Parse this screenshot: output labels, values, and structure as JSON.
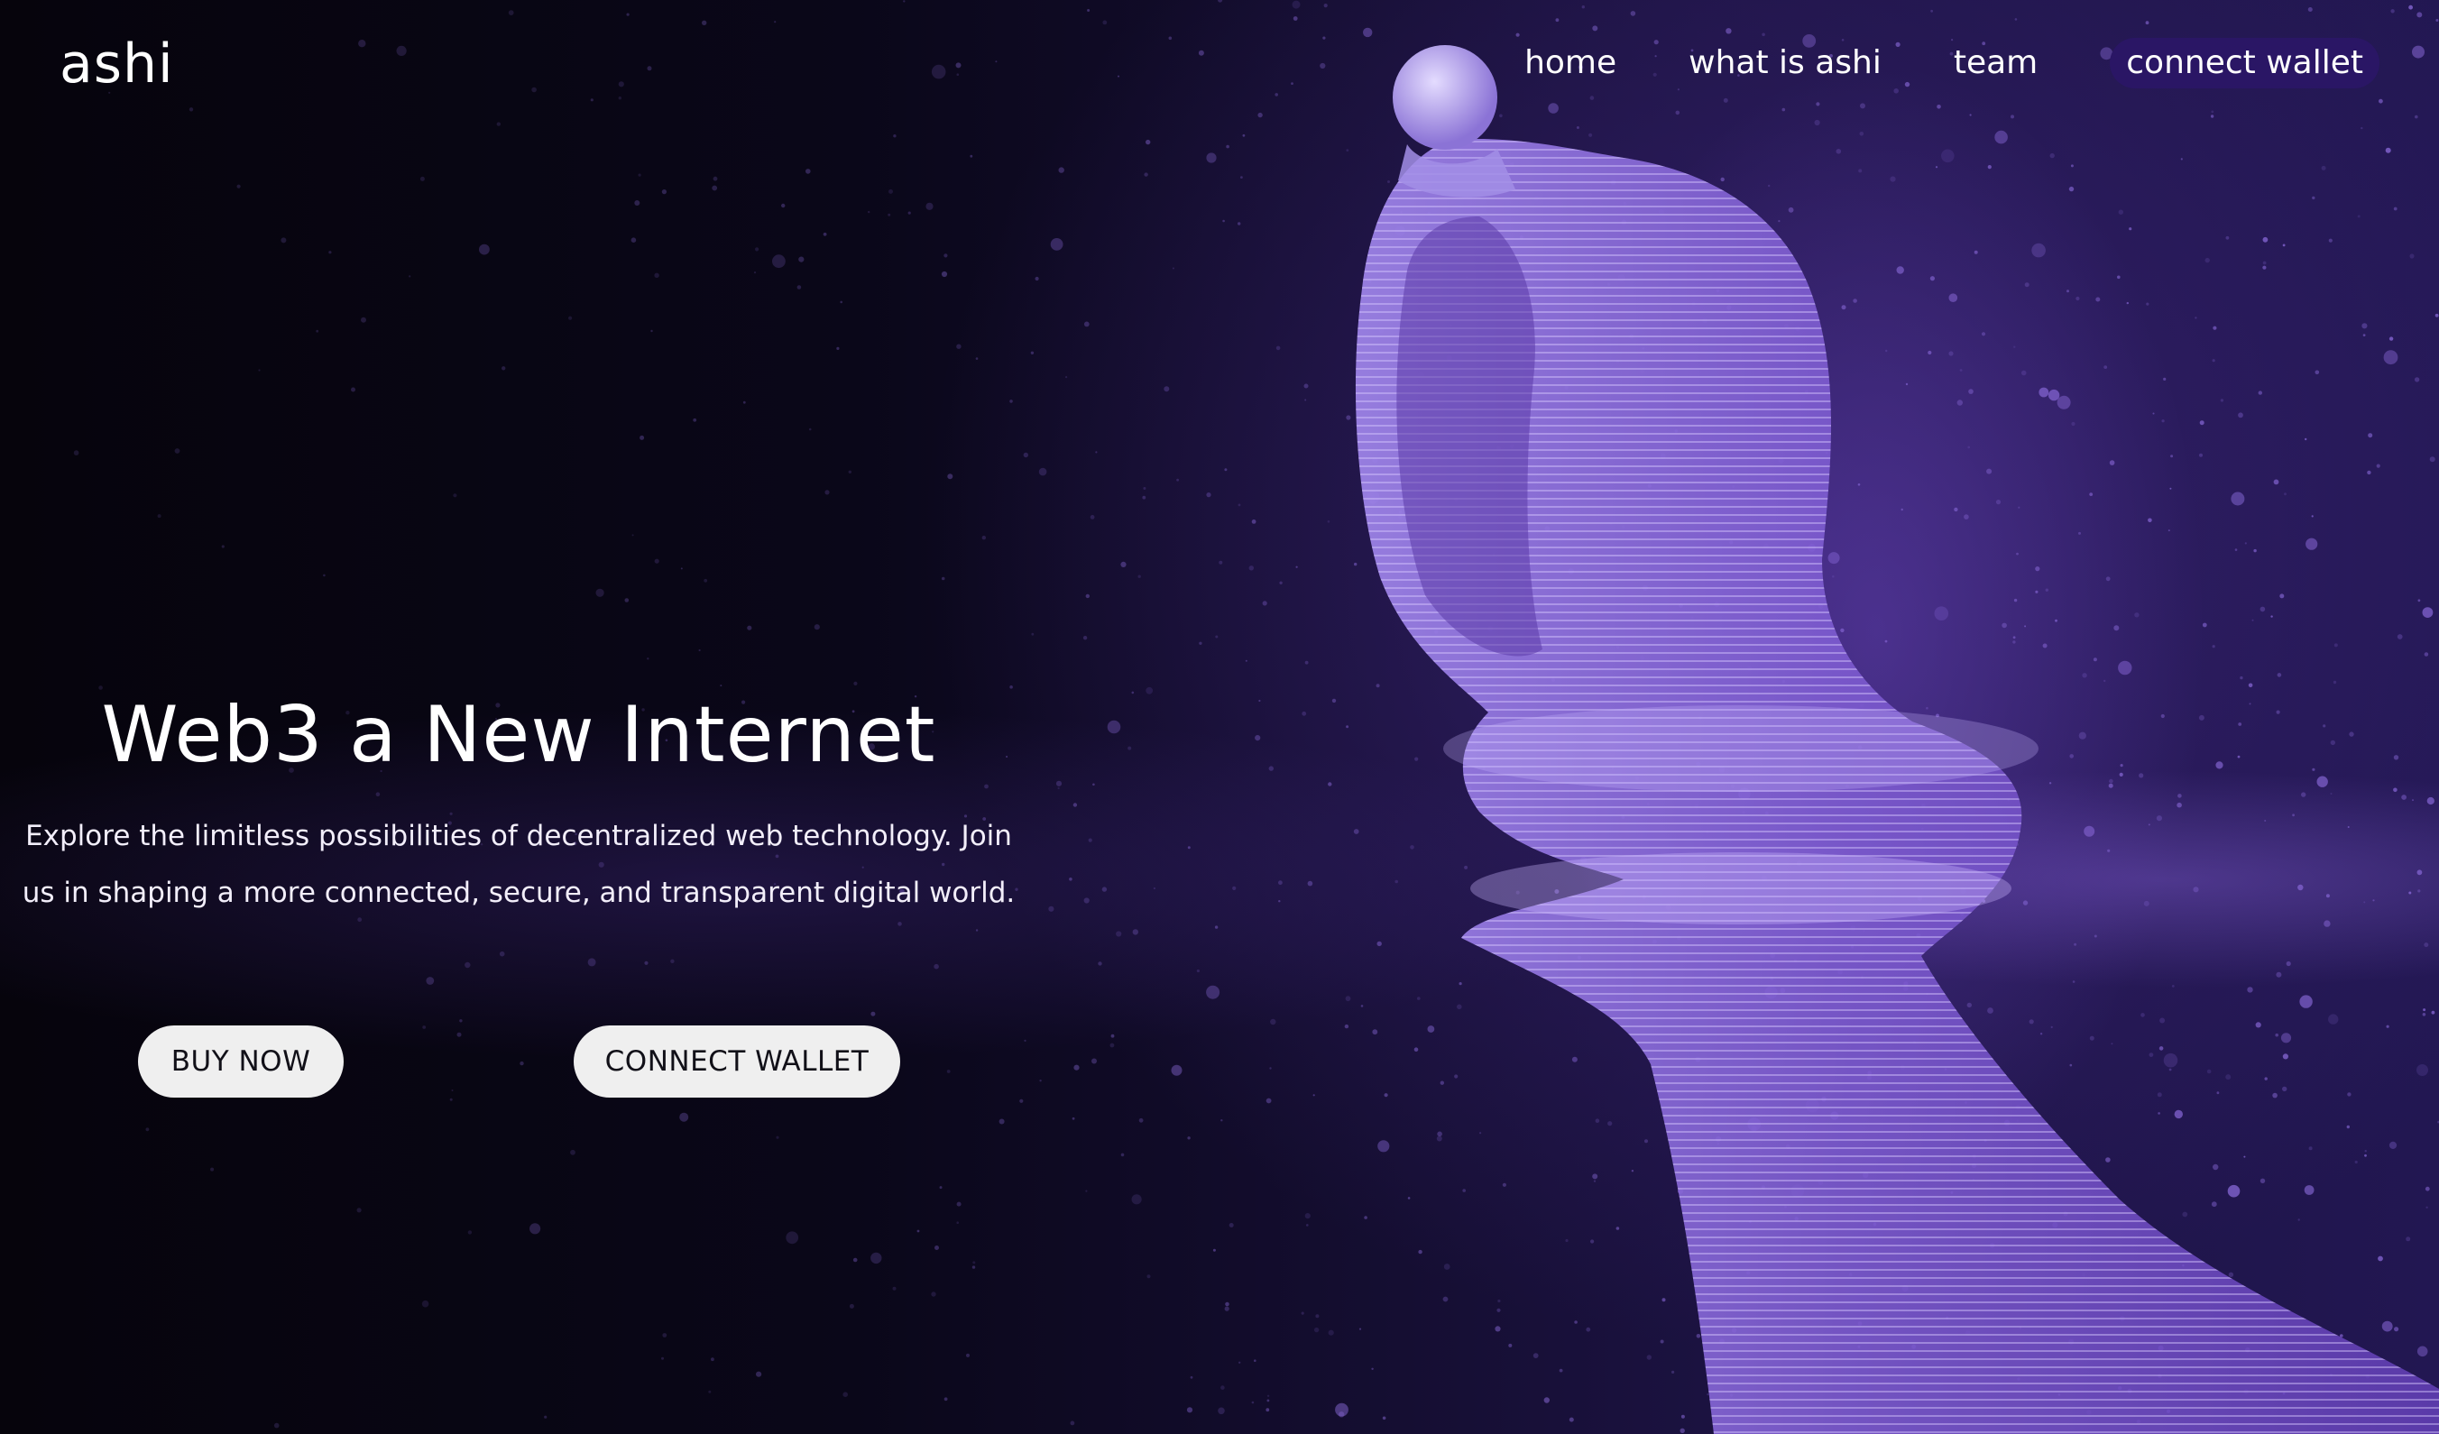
{
  "header": {
    "logo": "ashi",
    "nav": [
      {
        "label": "home"
      },
      {
        "label": "what is ashi"
      },
      {
        "label": "team"
      }
    ],
    "connect_label": "connect wallet"
  },
  "hero": {
    "title": "Web3 a New Internet",
    "subtitle": "Explore the limitless possibilities of decentralized web technology. Join us in shaping a more connected, secure, and transparent digital world.",
    "buy_label": "BUY NOW",
    "connect_label": "CONNECT WALLET"
  },
  "colors": {
    "accent": "#2a1665",
    "particle": "#8f6ee0",
    "button_bg": "#efefef"
  }
}
